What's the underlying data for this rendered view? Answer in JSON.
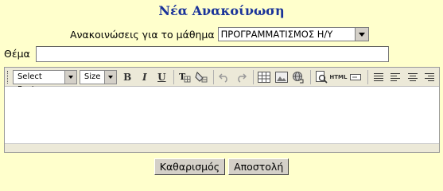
{
  "page": {
    "title": "Νέα Ανακοίνωση"
  },
  "course": {
    "label": "Ανακοινώσεις για το μάθημα",
    "selected": "ΠΡΟΓΡΑΜΜΑΤΙΣΜΟΣ Η/Υ"
  },
  "subject": {
    "label": "Θέμα",
    "value": ""
  },
  "editor": {
    "font_select": "Select Font",
    "size_select": "Size",
    "buttons": {
      "bold": "B",
      "italic": "I",
      "underline": "U",
      "html": "HTML"
    },
    "icons": [
      "text-color-icon",
      "highlight-icon",
      "undo-icon",
      "redo-icon",
      "insert-table-icon",
      "insert-image-icon",
      "insert-link-icon",
      "preview-icon",
      "html-mode-icon",
      "form-field-icon",
      "justify-icon",
      "align-left-icon",
      "align-center-icon",
      "align-right-icon"
    ]
  },
  "actions": {
    "clear_label": "Καθαρισμός",
    "submit_label": "Αποστολή"
  },
  "colors": {
    "background": "#ffffcc",
    "title": "#1a3399",
    "toolbar": "#ece9d8"
  }
}
